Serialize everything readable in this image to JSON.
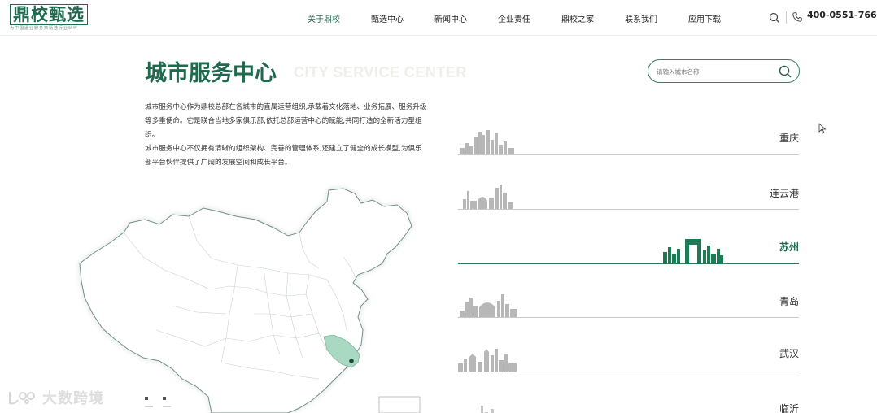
{
  "header": {
    "logo_text": "鼎校甄选",
    "logo_subtitle": "为中国酒业服务商甄选行业伙伴",
    "nav": [
      {
        "label": "关于鼎校",
        "active": true
      },
      {
        "label": "甄选中心",
        "active": false
      },
      {
        "label": "新闻中心",
        "active": false
      },
      {
        "label": "企业责任",
        "active": false
      },
      {
        "label": "鼎校之家",
        "active": false
      },
      {
        "label": "联系我们",
        "active": false
      },
      {
        "label": "应用下载",
        "active": false
      }
    ],
    "phone": "400-0551-766"
  },
  "page": {
    "title": "城市服务中心",
    "title_en": "CITY SERVICE CENTER",
    "intro_1": "城市服务中心作为鼎校总部在各城市的直属运营组织,承载着文化落地、业务拓展、服务升级等多重使命。它是联合当地多家俱乐部,依托总部运营中心的赋能,共同打造的全新活力型组织。",
    "intro_2": "城市服务中心不仅拥有清晰的组织架构、完善的管理体系,还建立了健全的成长模型,为俱乐部平台伙伴提供了广阔的发展空间和成长平台。"
  },
  "search": {
    "placeholder": "请输入城市名称"
  },
  "cities": [
    {
      "name": "重庆",
      "active": false
    },
    {
      "name": "连云港",
      "active": false
    },
    {
      "name": "苏州",
      "active": true
    },
    {
      "name": "青岛",
      "active": false
    },
    {
      "name": "武汉",
      "active": false
    },
    {
      "name": "临沂",
      "active": false
    }
  ],
  "map": {
    "highlight_color": "#a9d9c2",
    "marker_color": "#1f4a3a"
  },
  "colors": {
    "brand": "#1f6a4f",
    "inactive_line": "#c8ccc9",
    "skyline_gray": "#b7b7b7"
  },
  "watermark": "大数跨境"
}
